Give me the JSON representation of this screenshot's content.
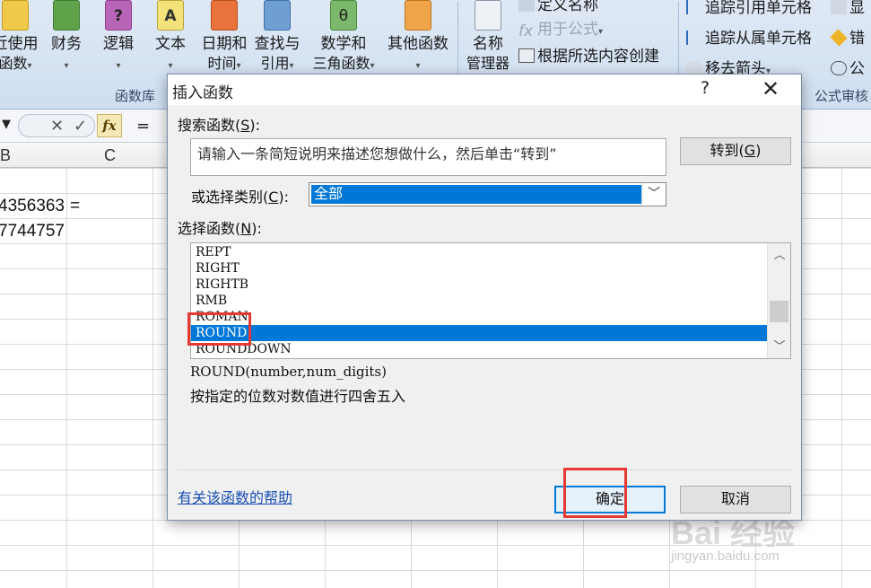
{
  "ribbon": {
    "buttons": [
      {
        "l1": "近使用",
        "l2": "函数"
      },
      {
        "l1": "财务",
        "l2": ""
      },
      {
        "l1": "逻辑",
        "l2": ""
      },
      {
        "l1": "文本",
        "l2": ""
      },
      {
        "l1": "日期和",
        "l2": "时间"
      },
      {
        "l1": "查找与",
        "l2": "引用"
      },
      {
        "l1": "数学和",
        "l2": "三角函数"
      },
      {
        "l1": "其他函数",
        "l2": ""
      },
      {
        "l1": "名称",
        "l2": "管理器"
      }
    ],
    "group_function_library": "函数库",
    "group_formula_audit": "公式审核",
    "define_name": "定义名称",
    "use_in_formula": "用于公式",
    "create_from_selection": "根据所选内容创建",
    "trace_precedents": "追踪引用单元格",
    "trace_dependents": "追踪从属单元格",
    "remove_arrows": "移去箭头",
    "show": "显",
    "error": "错",
    "evaluate": "公"
  },
  "formula_bar": {
    "cancel": "✕",
    "enter": "✓",
    "fx": "fx",
    "content": "="
  },
  "sheet": {
    "columns": {
      "b": "B",
      "c": "C"
    },
    "cells": {
      "b2": "4356363",
      "c2": "=",
      "b3": "7744757"
    }
  },
  "dialog": {
    "title": "插入函数",
    "help": "?",
    "close": "✕",
    "search_label": "搜索函数(",
    "search_key": "S",
    "search_tail": "):",
    "search_value": "请输入一条简短说明来描述您想做什么，然后单击“转到”",
    "go_label": "转到(",
    "go_key": "G",
    "go_tail": ")",
    "category_label": "或选择类别(",
    "category_key": "C",
    "category_tail": "):",
    "category_value": "全部",
    "select_label": "选择函数(",
    "select_key": "N",
    "select_tail": "):",
    "functions": [
      "REPT",
      "RIGHT",
      "RIGHTB",
      "RMB",
      "ROMAN",
      "ROUND",
      "ROUNDDOWN"
    ],
    "selected_function": "ROUND",
    "syntax": "ROUND(number,num_digits)",
    "description": "按指定的位数对数值进行四舍五入",
    "help_link": "有关该函数的帮助",
    "ok": "确定",
    "cancel": "取消"
  },
  "watermark": {
    "brand": "Bai 经验",
    "url": "jingyan.baidu.com"
  },
  "colors": {
    "accent": "#0078d7",
    "highlight": "#e53935",
    "link": "#1b50b5"
  }
}
